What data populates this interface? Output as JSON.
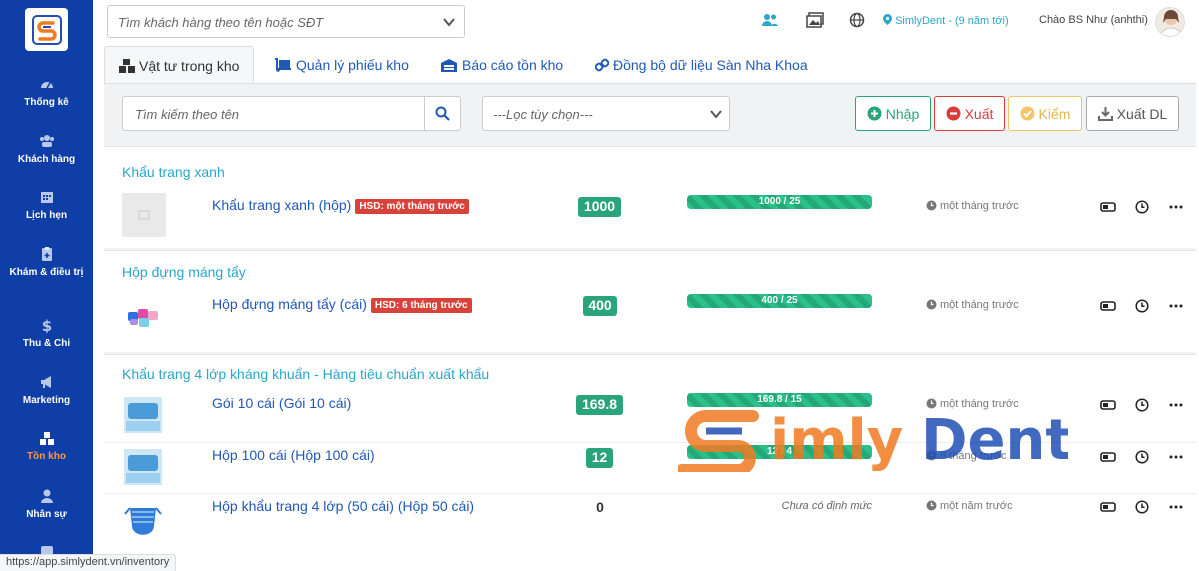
{
  "sidebar": {
    "items": [
      {
        "label": "Thống kê",
        "icon": "dashboard-icon"
      },
      {
        "label": "Khách hàng",
        "icon": "users-icon"
      },
      {
        "label": "Lịch hẹn",
        "icon": "calendar-icon"
      },
      {
        "label": "Khám & điều trị",
        "icon": "clipboard-icon"
      },
      {
        "label": "Thu & Chi",
        "icon": "dollar-icon"
      },
      {
        "label": "Marketing",
        "icon": "bullhorn-icon"
      },
      {
        "label": "Tồn kho",
        "icon": "boxes-icon",
        "active": true
      },
      {
        "label": "Nhân sự",
        "icon": "user-icon"
      }
    ]
  },
  "topbar": {
    "customer_search_placeholder": "Tìm khách hàng theo tên hoặc SĐT",
    "clinic_name": "SimlyDent - (9 năm tới)",
    "greeting": "Chào BS Như (anhthi)"
  },
  "tabs": [
    {
      "label": "Vật tư trong kho",
      "active": true
    },
    {
      "label": "Quản lý phiếu kho"
    },
    {
      "label": "Báo cáo tồn kho"
    },
    {
      "label": "Đồng bộ dữ liệu Sàn Nha Khoa"
    }
  ],
  "toolbar": {
    "search_placeholder": "Tìm kiếm theo tên",
    "filter_placeholder": "---Lọc tùy chọn---",
    "nhap_label": "Nhập",
    "xuat_label": "Xuất",
    "kiem_label": "Kiểm",
    "xuatdl_label": "Xuất DL"
  },
  "groups": [
    {
      "title": "Khẩu trang xanh",
      "items": [
        {
          "name": "Khẩu trang xanh (hộp)",
          "hsd": "HSD: một tháng trước",
          "qty": "1000",
          "bar": "1000 / 25",
          "time": "một tháng trước"
        }
      ]
    },
    {
      "title": "Hộp đựng máng tẩy",
      "items": [
        {
          "name": "Hộp đựng máng tẩy (cái)",
          "hsd": "HSD: 6 tháng trước",
          "qty": "400",
          "bar": "400 / 25",
          "time": "một tháng trước"
        }
      ]
    },
    {
      "title": "Khẩu trang 4 lớp kháng khuẩn - Hàng tiêu chuẩn xuất khẩu",
      "items": [
        {
          "name": "Gói 10 cái (Gói 10 cái)",
          "qty": "169.8",
          "bar": "169.8 / 15",
          "time": "một tháng trước"
        },
        {
          "name": "Hộp 100 cái (Hộp 100 cái)",
          "qty": "12",
          "bar": "12 / 4",
          "time": "8 tháng trước"
        },
        {
          "name": "Hộp khẩu trang 4 lớp (50 cái) (Hộp 50 cái)",
          "qty": "0",
          "norm": "Chưa có định mức",
          "time": "một năm trước"
        }
      ]
    }
  ],
  "watermark": "SimlyDent",
  "status_url": "https://app.simlydent.vn/inventory",
  "colors": {
    "sidebar": "#0f3fa6",
    "accent": "#2aa6c9",
    "green": "#2aa47a",
    "red": "#d93b3b",
    "active_nav": "#ff9a3c"
  }
}
